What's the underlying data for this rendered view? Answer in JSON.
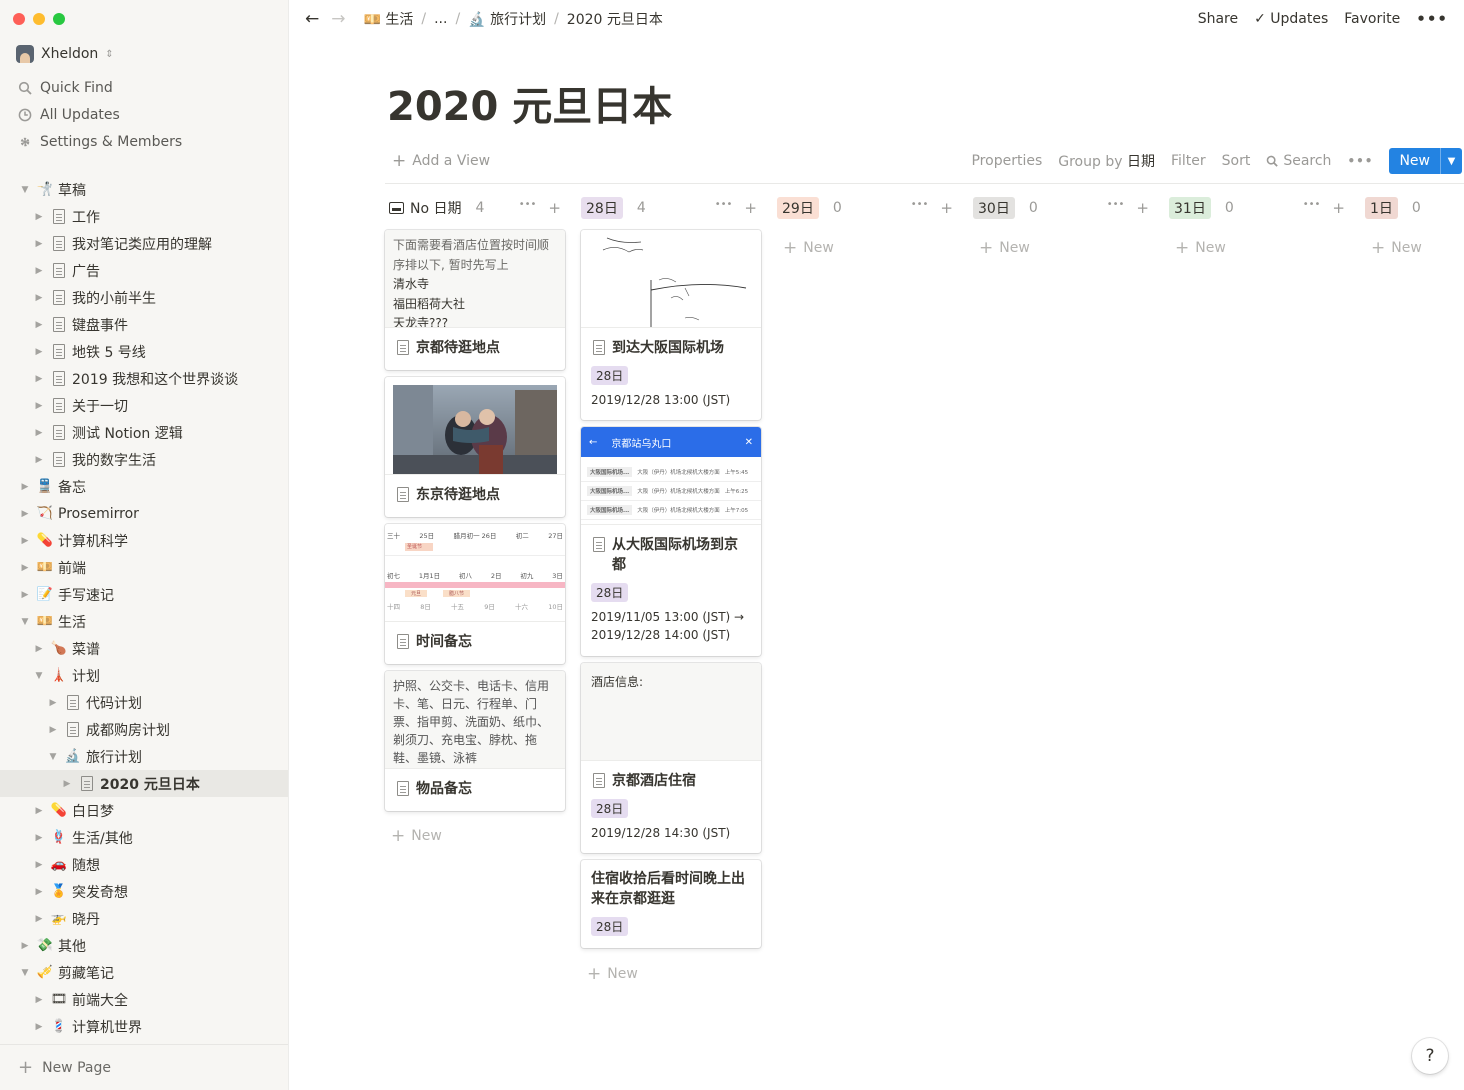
{
  "sidebar": {
    "workspace": "Xheldon",
    "menu": [
      {
        "label": "Quick Find",
        "icon": "search-icon"
      },
      {
        "label": "All Updates",
        "icon": "clock-icon"
      },
      {
        "label": "Settings & Members",
        "icon": "gear-icon"
      }
    ],
    "tree": [
      {
        "label": "草稿",
        "emoji": "🤺",
        "level": 0,
        "open": true
      },
      {
        "label": "工作",
        "page": true,
        "level": 1
      },
      {
        "label": "我对笔记类应用的理解",
        "page": true,
        "level": 1
      },
      {
        "label": "广告",
        "page": true,
        "level": 1
      },
      {
        "label": "我的小前半生",
        "page": true,
        "level": 1
      },
      {
        "label": "键盘事件",
        "page": true,
        "level": 1
      },
      {
        "label": "地铁 5 号线",
        "page": true,
        "level": 1
      },
      {
        "label": "2019 我想和这个世界谈谈",
        "page": true,
        "level": 1
      },
      {
        "label": "关于一切",
        "page": true,
        "level": 1
      },
      {
        "label": "测试 Notion 逻辑",
        "page": true,
        "level": 1
      },
      {
        "label": "我的数字生活",
        "page": true,
        "level": 1
      },
      {
        "label": "备忘",
        "emoji": "🚆",
        "level": 0
      },
      {
        "label": "Prosemirror",
        "emoji": "🏹",
        "level": 0
      },
      {
        "label": "计算机科学",
        "emoji": "💊",
        "level": 0
      },
      {
        "label": "前端",
        "emoji": "💴",
        "level": 0
      },
      {
        "label": "手写速记",
        "emoji": "📝",
        "level": 0
      },
      {
        "label": "生活",
        "emoji": "💴",
        "level": 0,
        "open": true
      },
      {
        "label": "菜谱",
        "emoji": "🍗",
        "level": 1
      },
      {
        "label": "计划",
        "emoji": "🗼",
        "level": 1,
        "open": true
      },
      {
        "label": "代码计划",
        "page": true,
        "level": 2
      },
      {
        "label": "成都购房计划",
        "page": true,
        "level": 2
      },
      {
        "label": "旅行计划",
        "emoji": "🔬",
        "level": 2,
        "open": true
      },
      {
        "label": "2020 元旦日本",
        "page": true,
        "level": 3,
        "active": true
      },
      {
        "label": "白日梦",
        "emoji": "💊",
        "level": 1
      },
      {
        "label": "生活/其他",
        "emoji": "🪢",
        "level": 1
      },
      {
        "label": "随想",
        "emoji": "🚗",
        "level": 1
      },
      {
        "label": "突发奇想",
        "emoji": "🏅",
        "level": 1
      },
      {
        "label": "晓丹",
        "emoji": "🚁",
        "level": 1
      },
      {
        "label": "其他",
        "emoji": "💸",
        "level": 0
      },
      {
        "label": "剪藏笔记",
        "emoji": "🎺",
        "level": 0,
        "open": true
      },
      {
        "label": "前端大全",
        "emoji": "🎞",
        "level": 1
      },
      {
        "label": "计算机世界",
        "emoji": "💈",
        "level": 1
      }
    ],
    "new_page": "New Page"
  },
  "topbar": {
    "crumbs": [
      {
        "label": "生活",
        "emoji": "💴"
      },
      {
        "label": "..."
      },
      {
        "label": "旅行计划",
        "emoji": "🔬"
      },
      {
        "label": "2020 元旦日本"
      }
    ],
    "share": "Share",
    "updates": "Updates",
    "favorite": "Favorite"
  },
  "page": {
    "title": "2020 元旦日本",
    "add_view": "Add a View",
    "properties": "Properties",
    "group_by": "Group by",
    "group_by_value": "日期",
    "filter": "Filter",
    "sort": "Sort",
    "search": "Search",
    "new": "New"
  },
  "board": {
    "columns": [
      {
        "label": "No 日期",
        "count": "4",
        "color": "none"
      },
      {
        "label": "28日",
        "count": "4",
        "color": "#e8deee"
      },
      {
        "label": "29日",
        "count": "0",
        "color": "#fadfd4"
      },
      {
        "label": "30日",
        "count": "0",
        "color": "#e3e2e0"
      },
      {
        "label": "31日",
        "count": "0",
        "color": "#dbeddb"
      },
      {
        "label": "1日",
        "count": "0",
        "color": "#f0d8d2"
      }
    ],
    "new_label": "New",
    "col0_cards": [
      {
        "preview_lines": [
          "下面需要看酒店位置按时间顺序排以下, 暂时先写上",
          "清水寺",
          "福田稻荷大社",
          "天龙寺???"
        ],
        "title": "京都待逛地点"
      },
      {
        "title": "东京待逛地点"
      },
      {
        "title": "时间备忘",
        "calendar": {
          "row1": [
            "三十",
            "25日",
            "腊月初一 26日",
            "初二",
            "27日"
          ],
          "row2": [
            "初七",
            "1月1日",
            "初八",
            "2日",
            "初九",
            "3日"
          ],
          "row3": [
            "十四",
            "8日",
            "十五",
            "9日",
            "十六",
            "10日"
          ],
          "badges": [
            "圣诞节",
            "元旦",
            "腊八节"
          ]
        }
      },
      {
        "preview_text": "护照、公交卡、电话卡、信用卡、笔、日元、行程单、门票、指甲剪、洗面奶、纸巾、剃须刀、充电宝、脖枕、拖鞋、墨镜、泳裤",
        "title": "物品备忘"
      }
    ],
    "col1_cards": [
      {
        "title": "到达大阪国际机场",
        "tag": "28日",
        "date": "2019/12/28 13:00 (JST)"
      },
      {
        "title": "从大阪国际机场到京都",
        "tag": "28日",
        "date": "2019/11/05 13:00 (JST) → 2019/12/28 14:00 (JST)",
        "map_header": "京都站乌丸口",
        "map_rows": [
          {
            "a": "大阪国际机场...",
            "b": "大阪（伊丹）机场北候机大楼方面",
            "t": "上午5:45"
          },
          {
            "a": "大阪国际机场...",
            "b": "大阪（伊丹）机场北候机大楼方面",
            "t": "上午6:25"
          },
          {
            "a": "大阪国际机场...",
            "b": "大阪（伊丹）机场北候机大楼方面",
            "t": "上午7:05"
          }
        ]
      },
      {
        "preview": "酒店信息:",
        "title": "京都酒店住宿",
        "tag": "28日",
        "date": "2019/12/28 14:30 (JST)"
      },
      {
        "title": "住宿收拾后看时间晚上出来在京都逛逛",
        "tag": "28日"
      }
    ]
  },
  "help": "?"
}
